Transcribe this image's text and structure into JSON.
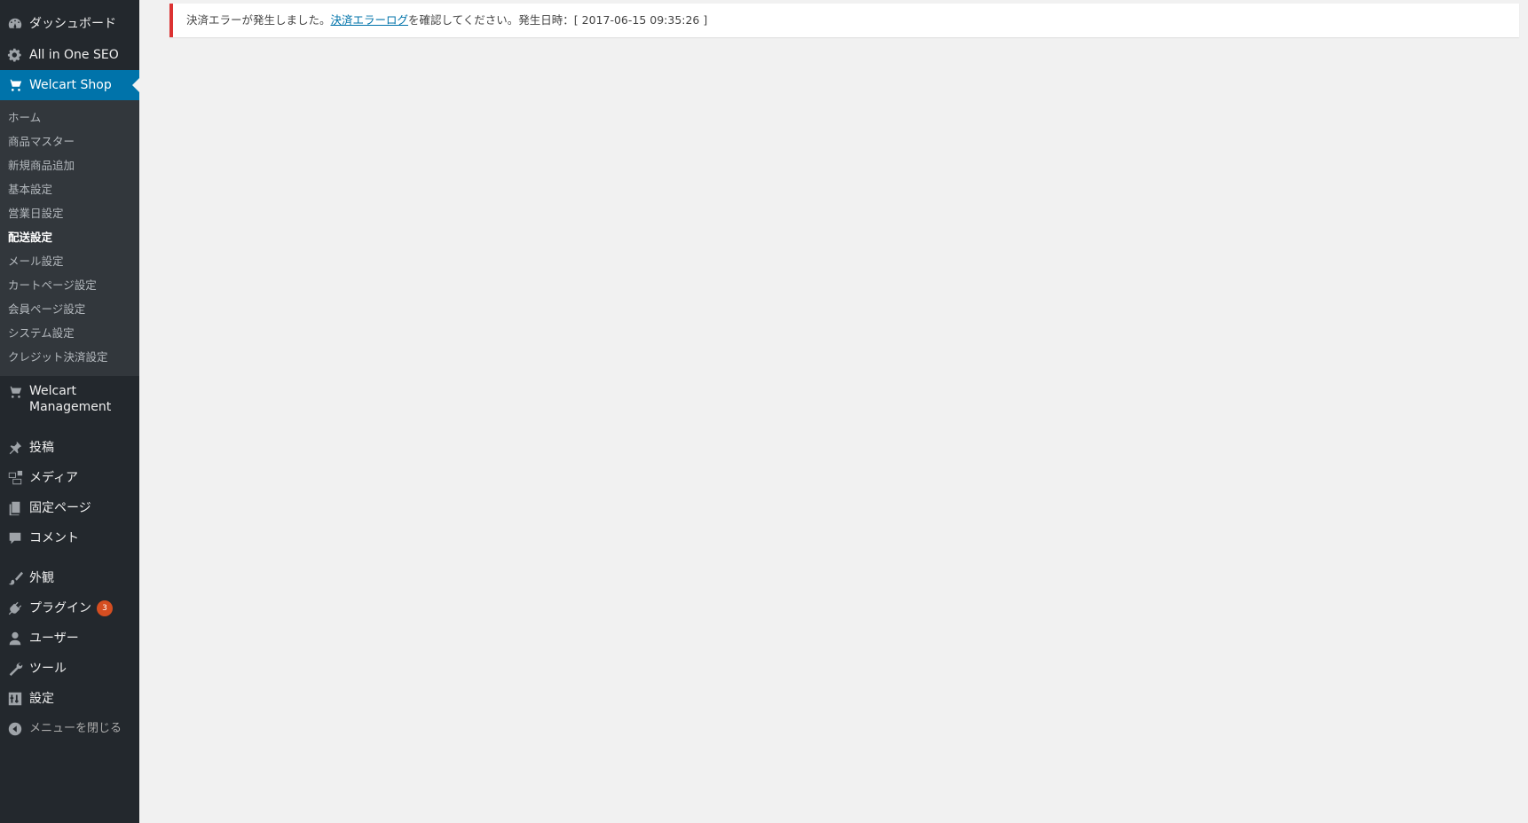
{
  "sidebar": {
    "top_items": [
      {
        "label": "ダッシュボード",
        "icon": "dashboard-icon"
      },
      {
        "label": "All in One SEO",
        "icon": "gear-icon"
      },
      {
        "label": "Welcart Shop",
        "icon": "cart-icon",
        "current": true
      }
    ],
    "submenu": [
      {
        "label": "ホーム"
      },
      {
        "label": "商品マスター"
      },
      {
        "label": "新規商品追加"
      },
      {
        "label": "基本設定"
      },
      {
        "label": "営業日設定"
      },
      {
        "label": "配送設定",
        "current": true
      },
      {
        "label": "メール設定"
      },
      {
        "label": "カートページ設定"
      },
      {
        "label": "会員ページ設定"
      },
      {
        "label": "システム設定"
      },
      {
        "label": "クレジット決済設定"
      }
    ],
    "management": {
      "line1": "Welcart",
      "line2": "Management",
      "icon": "cart-icon"
    },
    "items": [
      {
        "label": "投稿",
        "icon": "pin-icon"
      },
      {
        "label": "メディア",
        "icon": "media-icon"
      },
      {
        "label": "固定ページ",
        "icon": "pages-icon"
      },
      {
        "label": "コメント",
        "icon": "comment-icon"
      },
      {
        "label": "外観",
        "icon": "brush-icon"
      },
      {
        "label": "プラグイン",
        "icon": "plugin-icon",
        "badge": "3"
      },
      {
        "label": "ユーザー",
        "icon": "user-icon"
      },
      {
        "label": "ツール",
        "icon": "wrench-icon"
      },
      {
        "label": "設定",
        "icon": "settings-icon"
      }
    ],
    "collapse": {
      "label": "メニューを閉じる",
      "icon": "collapse-icon"
    }
  },
  "notice": {
    "before_link": "決済エラーが発生しました。",
    "link": "決済エラーログ",
    "after_link": "を確認してください。発生日時：[ 2017-06-15 09:35:26 ]"
  },
  "colors": {
    "sidebar_bg": "#23282d",
    "submenu_bg": "#32373c",
    "accent": "#0073aa",
    "error": "#dc3232",
    "badge": "#d54e21"
  }
}
